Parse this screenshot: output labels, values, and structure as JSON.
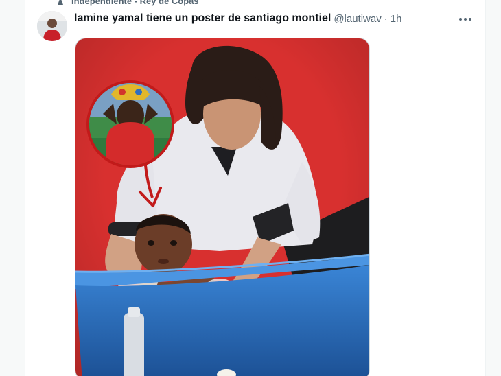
{
  "context": {
    "text": "Independiente - Rey de Copas",
    "icon": "pin-icon"
  },
  "tweet": {
    "display_name": "lamine yamal tiene un poster de santiago montiel",
    "handle": "@lautiwav",
    "separator": "·",
    "time": "1h",
    "more_icon": "more-horizontal-icon"
  },
  "colors": {
    "background_red": "#d8302f",
    "tub_blue": "#2a6fbe",
    "text_secondary": "#536471"
  }
}
